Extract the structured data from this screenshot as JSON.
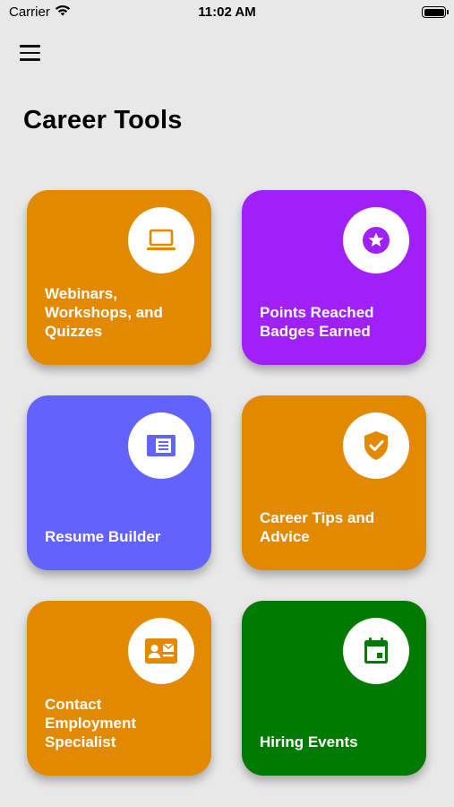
{
  "status_bar": {
    "carrier": "Carrier",
    "time": "11:02 AM"
  },
  "page": {
    "title": "Career Tools"
  },
  "tiles": [
    {
      "label": "Webinars,\nWorkshops, and\nQuizzes",
      "color": "#e38900",
      "icon": "laptop-icon"
    },
    {
      "label": "Points Reached\nBadges Earned",
      "color": "#9f20f8",
      "icon": "star-badge-icon"
    },
    {
      "label": "Resume Builder",
      "color": "#6262fd",
      "icon": "resume-icon"
    },
    {
      "label": "Career Tips and\nAdvice",
      "color": "#e38900",
      "icon": "shield-check-icon"
    },
    {
      "label": "Contact\nEmployment\nSpecialist",
      "color": "#e38900",
      "icon": "contact-card-icon"
    },
    {
      "label": "Hiring Events",
      "color": "#007a00",
      "icon": "calendar-icon"
    }
  ]
}
